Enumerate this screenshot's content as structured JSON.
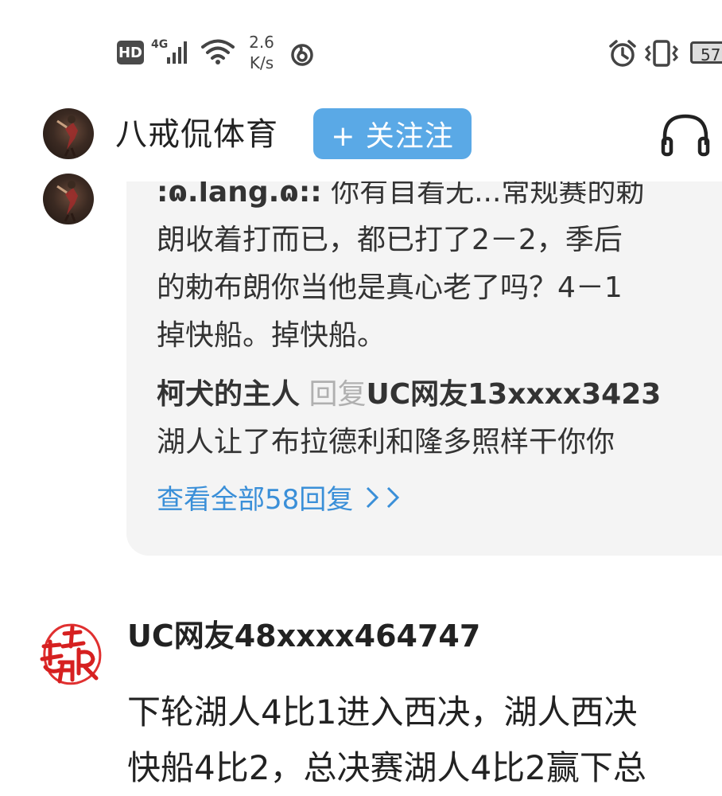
{
  "status_bar": {
    "hd_label": "HD",
    "network_label": "4G",
    "speed_value": "2.6",
    "speed_unit": "K/s",
    "battery_level": "57"
  },
  "header": {
    "author_name": "八戒侃体育",
    "follow_label": "+ 关注注"
  },
  "reply_card": {
    "line1_user": ":ɷ.lang.ɷ::",
    "line1_text": " 你有自看无...常规赛的勅",
    "line2": "朗收着打而已，都已打了2－2，季后",
    "line3": "的勅布朗你当他是真心老了吗？4－1",
    "line4": "掉快船。掉快船。",
    "reply2_user": "柯犬的主人",
    "reply2_keyword": "回复",
    "reply2_target": "UC网友13xxxx3423",
    "reply2_text": "湖人让了布拉德利和隆多照样干你你",
    "view_all_label": "查看全部58回复"
  },
  "comment2": {
    "username": "UC网友48xxxx464747",
    "line1": "下轮湖人4比1进入西决，湖人西决",
    "line2": "快船4比2，总决赛湖人4比2赢下总"
  }
}
